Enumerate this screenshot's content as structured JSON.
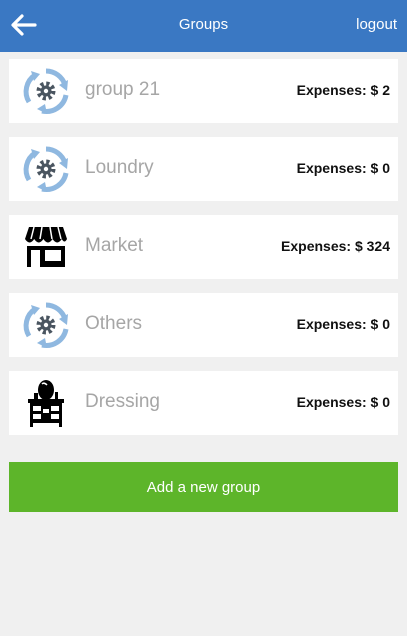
{
  "header": {
    "title": "Groups",
    "logout_label": "logout",
    "back_icon": "back-arrow-icon",
    "bg_color": "#3a78c3"
  },
  "groups": [
    {
      "name": "group 21",
      "expenses": "Expenses: $ 2",
      "icon": "cycle-gear-icon"
    },
    {
      "name": "Loundry",
      "expenses": "Expenses: $ 0",
      "icon": "cycle-gear-icon"
    },
    {
      "name": "Market",
      "expenses": "Expenses: $ 324",
      "icon": "storefront-icon"
    },
    {
      "name": "Others",
      "expenses": "Expenses: $ 0",
      "icon": "cycle-gear-icon"
    },
    {
      "name": "Dressing",
      "expenses": "Expenses: $ 0",
      "icon": "dressing-table-icon"
    }
  ],
  "add_button": {
    "label": "Add a new group",
    "color": "#5db52a"
  }
}
